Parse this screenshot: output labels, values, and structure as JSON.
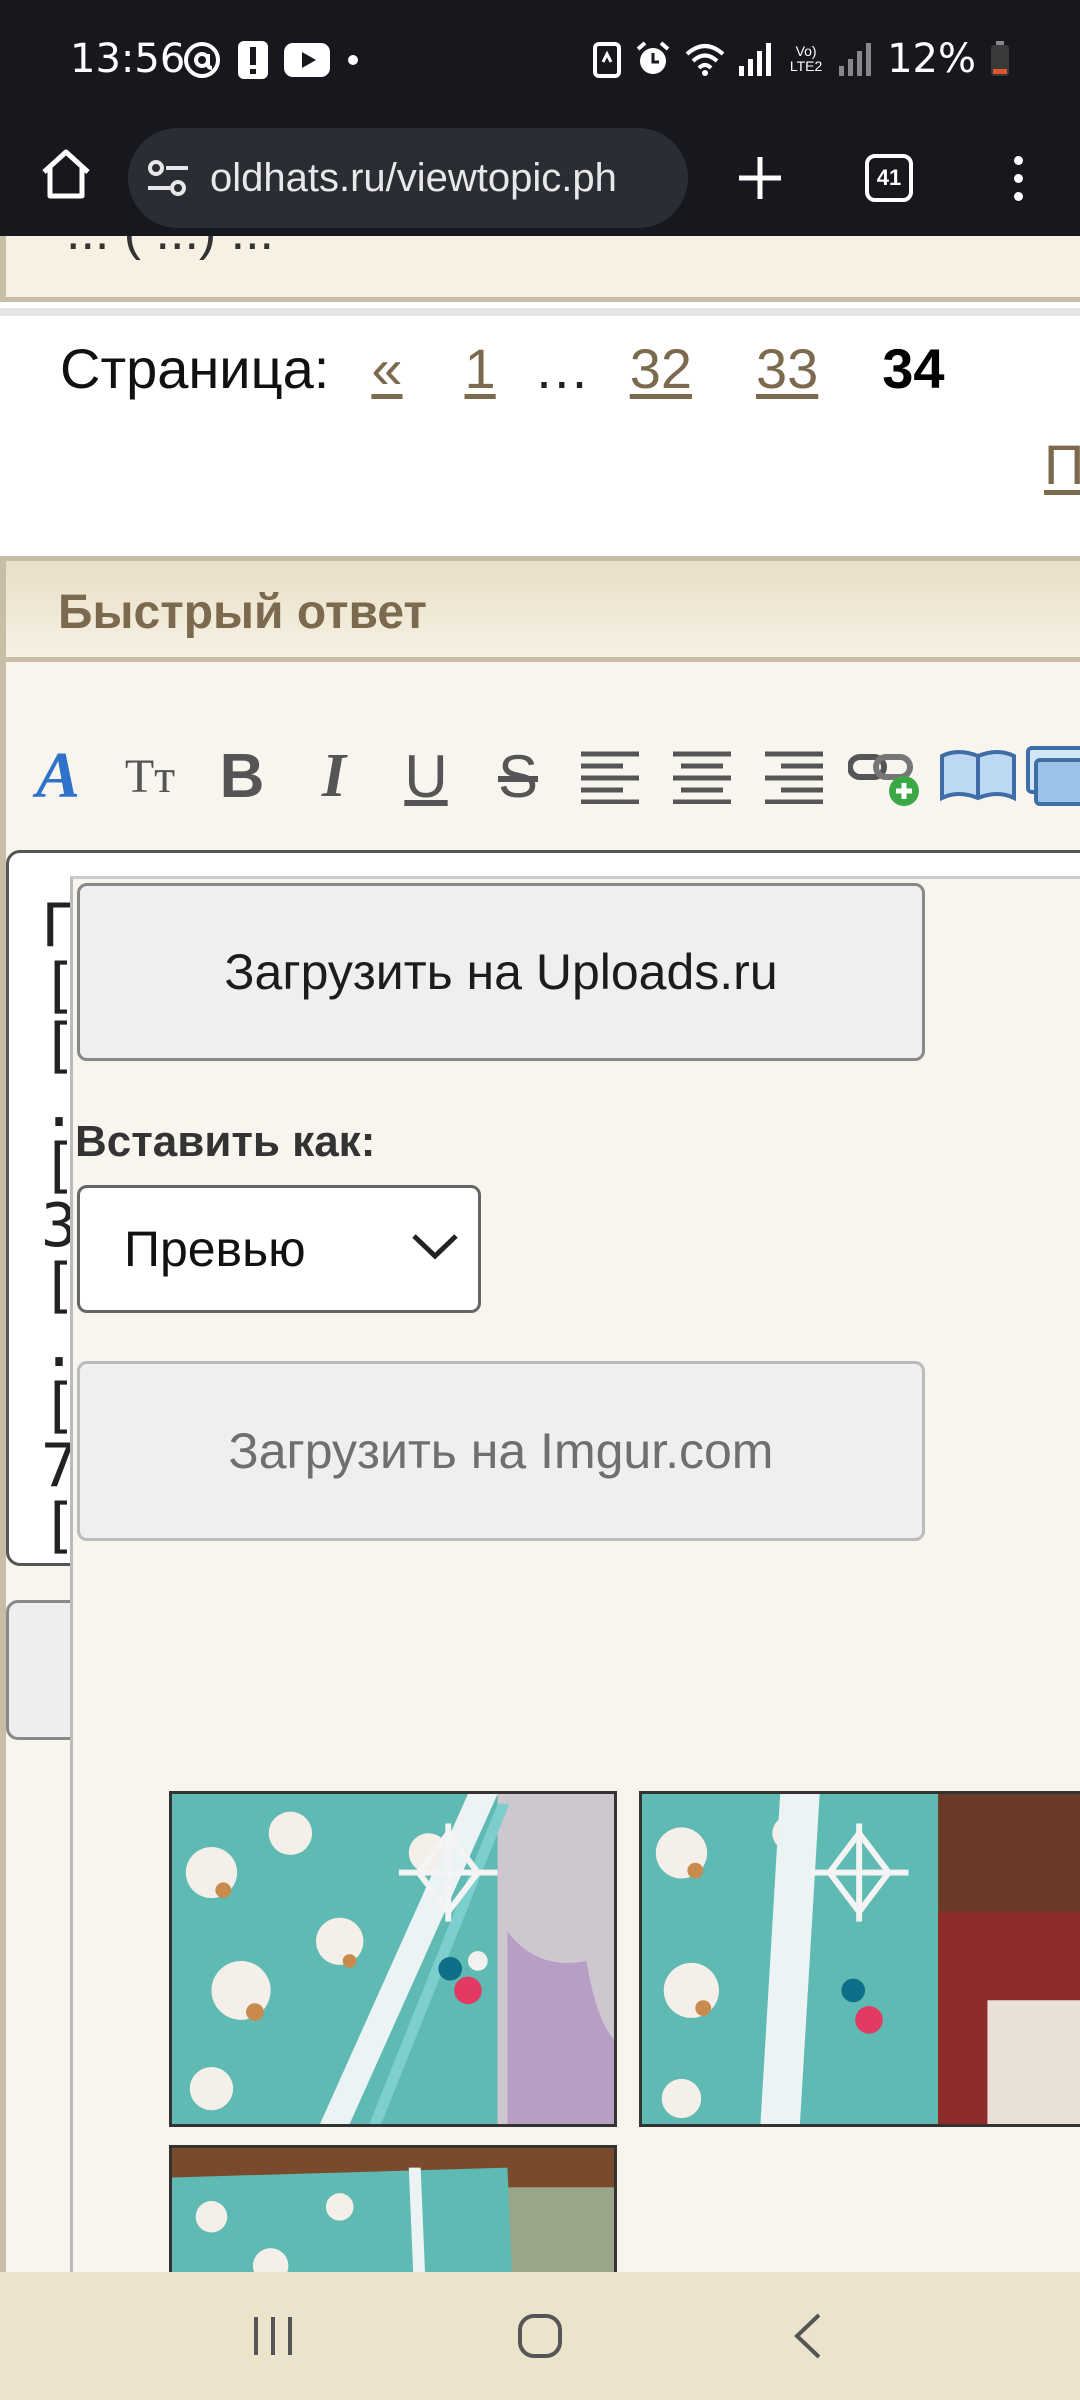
{
  "status_bar": {
    "time": "13:56",
    "battery_percent": "12%",
    "network_label": "Vo) LTE2"
  },
  "browser": {
    "url": "oldhats.ru/viewtopic.ph",
    "tab_count": "41"
  },
  "page": {
    "header_fragment": "... ( ...) ...",
    "pagination": {
      "label": "Страница:",
      "prev": "«",
      "pages": [
        "1",
        "…",
        "32",
        "33"
      ],
      "current": "34",
      "next_fragment": "П"
    },
    "quick_reply": {
      "title": "Быстрый ответ",
      "toolbar_labels": {
        "font": "A",
        "text_size": "Tт",
        "bold": "B",
        "italic": "I",
        "underline": "U",
        "strike": "S"
      },
      "textarea_lines": [
        "Г",
        "[i",
        "[u",
        ".j",
        "[i",
        "3",
        "[u",
        ".j",
        "[i",
        "7",
        "",
        "[/"
      ],
      "under_button_fragment": "-"
    },
    "upload_popup": {
      "uploads_button": "Загрузить на Uploads.ru",
      "insert_as_label": "Вставить как:",
      "insert_as_value": "Превью",
      "imgur_button": "Загрузить на Imgur.com"
    }
  },
  "colors": {
    "status_bg": "#17181d",
    "link": "#7b6a4e",
    "panel_bg": "#f8f5ee",
    "header_bg": "#e9dfc7",
    "nav_bg": "#ece3cc",
    "fabric_teal": "#5fbab3"
  }
}
